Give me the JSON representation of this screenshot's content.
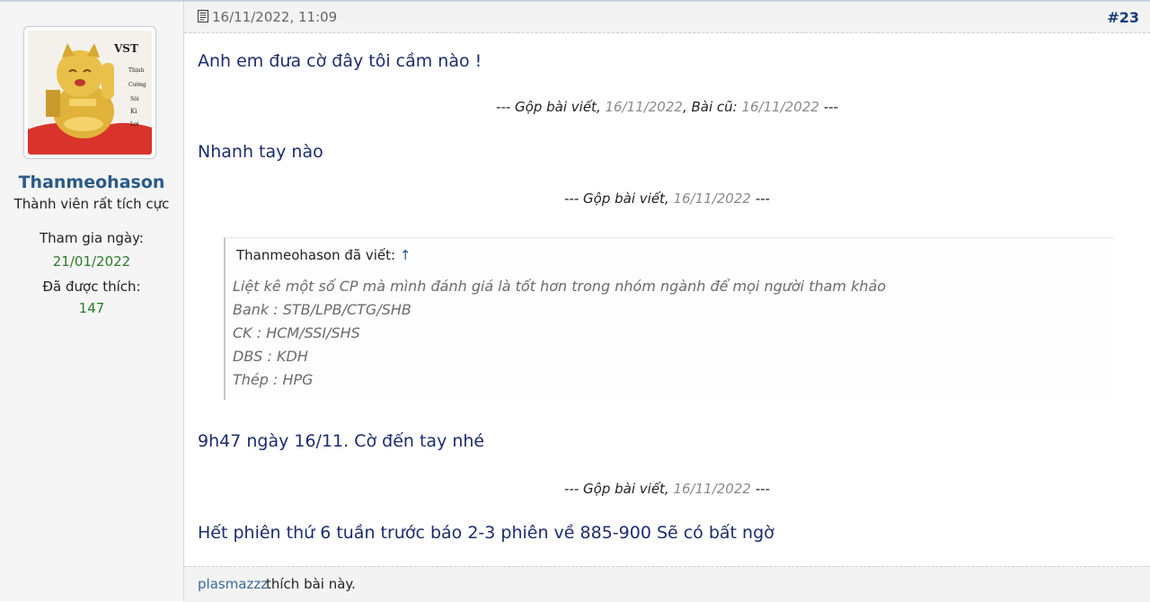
{
  "user": {
    "name": "Thanmeohason",
    "title": "Thành viên rất tích cực",
    "joined_label": "Tham gia ngày:",
    "joined_value": "21/01/2022",
    "likes_label": "Đã được thích:",
    "likes_value": "147",
    "avatar_text": "VST"
  },
  "post": {
    "datetime": "16/11/2022, 11:09",
    "number": "#23",
    "message1": "Anh em đưa cờ đây tôi cầm nào !",
    "merge1_prefix": "--- Gộp bài viết, ",
    "merge1_date": "16/11/2022",
    "merge1_mid": ", Bài cũ: ",
    "merge1_old": "16/11/2022",
    "merge1_suffix": " ---",
    "message2": "Nhanh tay nào",
    "merge2_prefix": "--- Gộp bài viết, ",
    "merge2_date": "16/11/2022",
    "merge2_suffix": " ---",
    "quote": {
      "author": "Thanmeohason đã viết:",
      "arrow": "↑",
      "lines": [
        "Liệt kê một số CP mà mình đánh giá là tốt hơn trong nhóm ngành để mọi người tham khảo",
        "Bank : STB/LPB/CTG/SHB",
        "CK : HCM/SSI/SHS",
        "DBS : KDH",
        "Thép : HPG"
      ]
    },
    "message3": "9h47 ngày 16/11. Cờ đến tay nhé",
    "merge3_prefix": "--- Gộp bài viết, ",
    "merge3_date": "16/11/2022",
    "merge3_suffix": " ---",
    "message4": "Hết phiên thứ 6 tuần trước báo 2-3 phiên về 885-900 Sẽ có bất ngờ"
  },
  "likes": {
    "user": "plasmazzz",
    "text": "thích bài này."
  },
  "colors": {
    "message": "#1c2c6e",
    "username": "#2a5a8a",
    "green": "#2d7a2d",
    "post_number": "#1a3a78"
  }
}
